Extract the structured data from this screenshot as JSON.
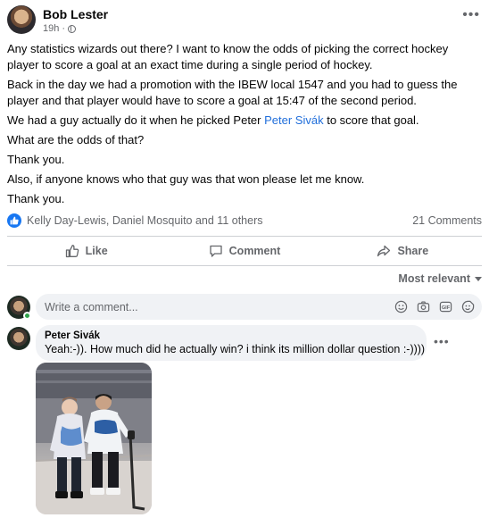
{
  "post": {
    "author": "Bob Lester",
    "time": "19h",
    "body": [
      "Any statistics wizards out there? I want to know the odds of picking the correct hockey player to score a goal at an exact time during a single period of hockey.",
      "Back in the day we had a promotion with the IBEW local 1547 and you had to guess the player and that player would have to score a goal at 15:47 of the second period.",
      "What are the odds of that?",
      "Thank you.",
      "Also, if anyone knows who that guy was that won please let me know.",
      "Thank you."
    ],
    "mention_line": {
      "before": "We had a guy actually do it when he picked Peter ",
      "mention": "Peter Sivák",
      "after": " to score that goal."
    }
  },
  "reactions": {
    "reactors": "Kelly Day-Lewis, Daniel Mosquito and 11 others",
    "comments": "21 Comments"
  },
  "actions": {
    "like": "Like",
    "comment": "Comment",
    "share": "Share"
  },
  "sort_label": "Most relevant",
  "composer": {
    "placeholder": "Write a comment..."
  },
  "comment": {
    "author": "Peter Sivák",
    "text": "Yeah:-)). How much did he actually win? i think its million dollar question :-))))"
  },
  "colors": {
    "accent": "#1877f2",
    "mention": "#216fdb",
    "secondary_text": "#65676b",
    "online": "#31a24c"
  }
}
